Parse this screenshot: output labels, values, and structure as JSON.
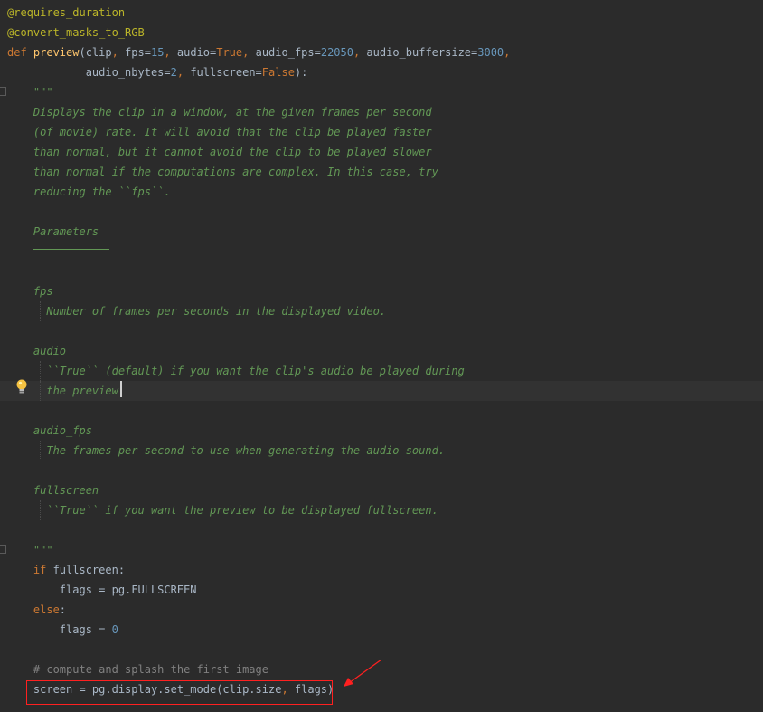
{
  "editor": {
    "lines": [
      {
        "segments": [
          {
            "c": "decor",
            "t": "@requires_duration"
          }
        ]
      },
      {
        "segments": [
          {
            "c": "decor",
            "t": "@convert_masks_to_RGB"
          }
        ]
      },
      {
        "segments": [
          {
            "c": "kw",
            "t": "def "
          },
          {
            "c": "fn",
            "t": "preview"
          },
          {
            "c": "txt",
            "t": "(clip"
          },
          {
            "c": "kw",
            "t": ", "
          },
          {
            "c": "txt",
            "t": "fps="
          },
          {
            "c": "num",
            "t": "15"
          },
          {
            "c": "kw",
            "t": ", "
          },
          {
            "c": "txt",
            "t": "audio="
          },
          {
            "c": "kw",
            "t": "True"
          },
          {
            "c": "kw",
            "t": ", "
          },
          {
            "c": "txt",
            "t": "audio_fps="
          },
          {
            "c": "num",
            "t": "22050"
          },
          {
            "c": "kw",
            "t": ", "
          },
          {
            "c": "txt",
            "t": "audio_buffersize="
          },
          {
            "c": "num",
            "t": "3000"
          },
          {
            "c": "kw",
            "t": ","
          }
        ]
      },
      {
        "segments": [
          {
            "c": "txt",
            "t": "            audio_nbytes="
          },
          {
            "c": "num",
            "t": "2"
          },
          {
            "c": "kw",
            "t": ", "
          },
          {
            "c": "txt",
            "t": "fullscreen="
          },
          {
            "c": "kw",
            "t": "False"
          },
          {
            "c": "txt",
            "t": "):"
          }
        ]
      },
      {
        "segments": [
          {
            "c": "doc",
            "t": "    \"\"\""
          }
        ]
      },
      {
        "segments": [
          {
            "c": "doc",
            "t": "    Displays the clip in a window, at the given frames per second"
          }
        ]
      },
      {
        "segments": [
          {
            "c": "doc",
            "t": "    (of movie) rate. It will avoid that the clip be played faster"
          }
        ]
      },
      {
        "segments": [
          {
            "c": "doc",
            "t": "    than normal, but it cannot avoid the clip to be played slower"
          }
        ]
      },
      {
        "segments": [
          {
            "c": "doc",
            "t": "    than normal if the computations are complex. In this case, try"
          }
        ]
      },
      {
        "segments": [
          {
            "c": "doc",
            "t": "    reducing the ``fps``."
          }
        ]
      },
      {
        "segments": []
      },
      {
        "segments": [
          {
            "c": "doc",
            "t": "    Parameters"
          }
        ]
      },
      {
        "segments": []
      },
      {
        "segments": []
      },
      {
        "segments": [
          {
            "c": "doc",
            "t": "    fps"
          }
        ]
      },
      {
        "segments": [
          {
            "c": "doc",
            "t": "      Number of frames per seconds in the displayed video."
          }
        ]
      },
      {
        "segments": []
      },
      {
        "segments": [
          {
            "c": "doc",
            "t": "    audio"
          }
        ]
      },
      {
        "segments": [
          {
            "c": "doc",
            "t": "      ``True`` (default) if you want the clip's audio be played during"
          }
        ]
      },
      {
        "segments": [
          {
            "c": "doc",
            "t": "      the preview."
          }
        ]
      },
      {
        "segments": []
      },
      {
        "segments": [
          {
            "c": "doc",
            "t": "    audio_fps"
          }
        ]
      },
      {
        "segments": [
          {
            "c": "doc",
            "t": "      The frames per second to use when generating the audio sound."
          }
        ]
      },
      {
        "segments": []
      },
      {
        "segments": [
          {
            "c": "doc",
            "t": "    fullscreen"
          }
        ]
      },
      {
        "segments": [
          {
            "c": "doc",
            "t": "      ``True`` if you want the preview to be displayed fullscreen."
          }
        ]
      },
      {
        "segments": []
      },
      {
        "segments": [
          {
            "c": "doc",
            "t": "    \"\"\""
          }
        ]
      },
      {
        "segments": [
          {
            "c": "kw",
            "t": "    if "
          },
          {
            "c": "txt",
            "t": "fullscreen:"
          }
        ]
      },
      {
        "segments": [
          {
            "c": "txt",
            "t": "        flags = pg.FULLSCREEN"
          }
        ]
      },
      {
        "segments": [
          {
            "c": "kw",
            "t": "    else"
          },
          {
            "c": "txt",
            "t": ":"
          }
        ]
      },
      {
        "segments": [
          {
            "c": "txt",
            "t": "        flags = "
          },
          {
            "c": "num",
            "t": "0"
          }
        ]
      },
      {
        "segments": []
      },
      {
        "segments": [
          {
            "c": "cmt",
            "t": "    # compute and splash the first image"
          }
        ]
      },
      {
        "segments": [
          {
            "c": "txt",
            "t": "    screen = pg.display.set_mode(clip.size"
          },
          {
            "c": "kw",
            "t": ", "
          },
          {
            "c": "txt",
            "t": "flags)"
          }
        ]
      }
    ]
  },
  "colors": {
    "background": "#2b2b2b",
    "keyword": "#cc7832",
    "function": "#ffc66d",
    "number": "#6897bb",
    "docstring": "#629755",
    "decorator": "#bbb529",
    "annotation_red": "#ff2020"
  },
  "icons": {
    "intention_bulb": "lightbulb-icon",
    "annotation_arrow": "red-arrow-icon"
  }
}
